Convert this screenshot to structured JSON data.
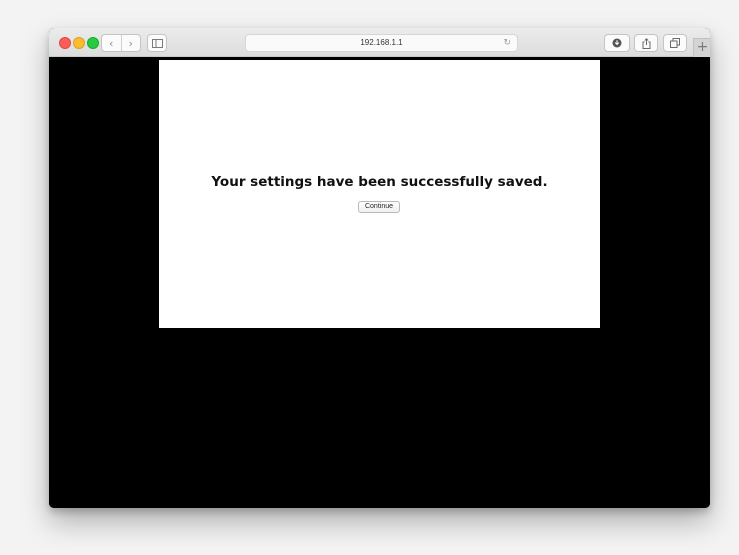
{
  "browser": {
    "address": "192.168.1.1",
    "back_icon": "‹",
    "forward_icon": "›",
    "reload_icon": "↻",
    "new_tab_icon": "+"
  },
  "page": {
    "message": "Your settings have been successfully saved.",
    "continue_label": "Continue"
  },
  "colors": {
    "page_background": "#000000",
    "panel_background": "#ffffff",
    "traffic_close": "#fc5f57",
    "traffic_minimize": "#fdbc2e",
    "traffic_maximize": "#29c940"
  }
}
